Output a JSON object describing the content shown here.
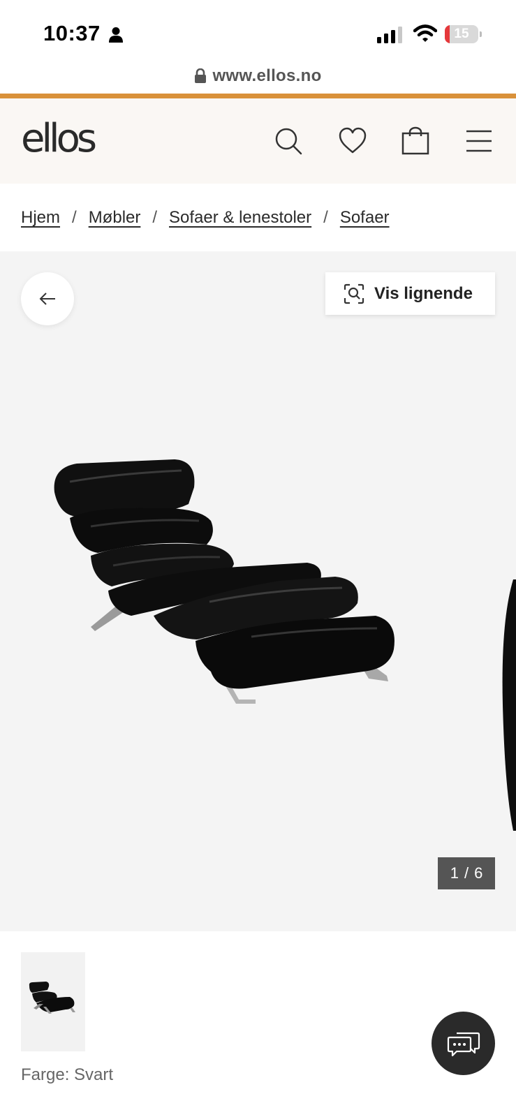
{
  "status_bar": {
    "time": "10:37",
    "battery_percent": "15",
    "battery_level": 0.15,
    "icons": [
      "person-icon",
      "signal-icon",
      "wifi-icon",
      "battery-icon"
    ]
  },
  "browser": {
    "url": "www.ellos.no"
  },
  "header": {
    "logo": "ellos",
    "icons": [
      "search-icon",
      "heart-icon",
      "shopping-bag-icon",
      "menu-icon"
    ]
  },
  "breadcrumb": {
    "items": [
      {
        "label": "Hjem"
      },
      {
        "label": "Møbler"
      },
      {
        "label": "Sofaer & lenestoler"
      },
      {
        "label": "Sofaer"
      }
    ],
    "separator": "/"
  },
  "gallery": {
    "similar_button": "Vis lignende",
    "counter_current": "1",
    "counter_separator": "/",
    "counter_total": "6"
  },
  "product": {
    "color_label": "Farge: Svart"
  },
  "colors": {
    "accent": "#d9913a",
    "header_bg": "#faf7f4",
    "gallery_bg": "#f4f4f4",
    "counter_bg": "#555555",
    "chat_button": "#2a2a2a"
  }
}
